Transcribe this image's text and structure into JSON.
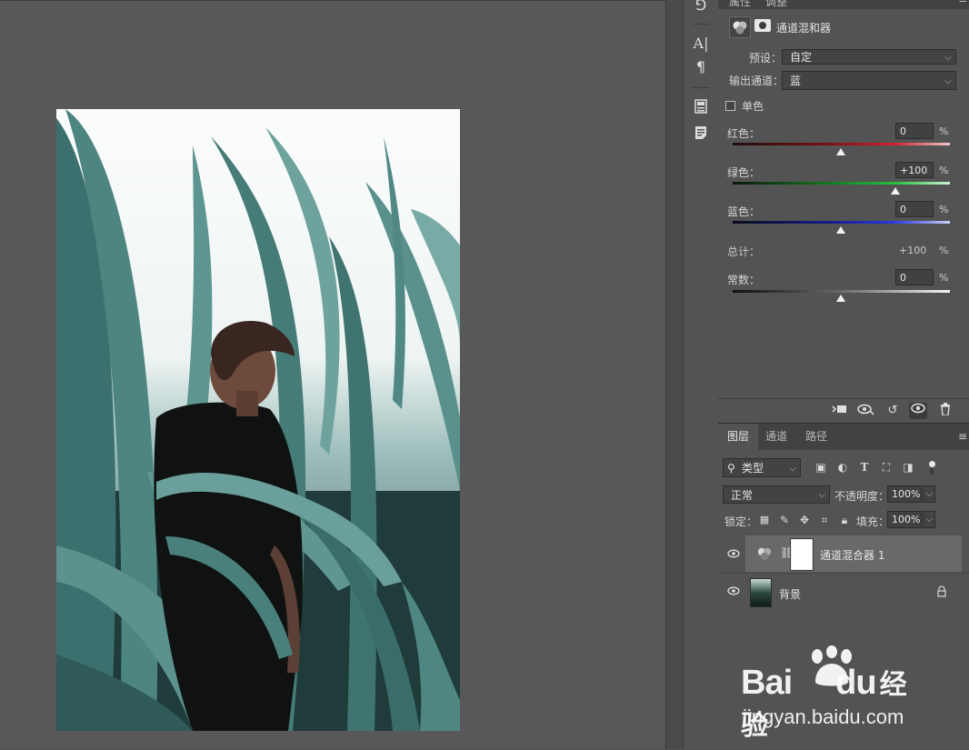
{
  "properties": {
    "tabs": [
      "属性",
      "调整"
    ],
    "title": "通道混和器",
    "preset_label": "预设：",
    "preset_value": "自定",
    "output_label": "输出通道：",
    "output_value": "蓝",
    "mono_label": "单色",
    "channels": [
      {
        "label": "红色：",
        "value": "0",
        "percent": "%",
        "color": "#c8202a",
        "slider": 0.5
      },
      {
        "label": "绿色：",
        "value": "+100",
        "percent": "%",
        "color": "#22b53a",
        "slider": 0.75
      },
      {
        "label": "蓝色：",
        "value": "0",
        "percent": "%",
        "color": "#2633d6",
        "slider": 0.5
      }
    ],
    "total_label": "总计：",
    "total_value": "+100",
    "total_percent": "%",
    "constant_label": "常数：",
    "constant_value": "0",
    "constant_percent": "%",
    "constant_slider": 0.5
  },
  "layers_panel": {
    "tabs": [
      "图层",
      "通道",
      "路径"
    ],
    "filter_label": "类型",
    "blend_mode": "正常",
    "opacity_label": "不透明度：",
    "opacity_value": "100%",
    "lock_label": "锁定：",
    "fill_label": "填充：",
    "fill_value": "100%",
    "layers": [
      {
        "name": "通道混合器 1",
        "selected": true
      },
      {
        "name": "背景",
        "selected": false
      }
    ]
  },
  "watermark": {
    "brand": "Bai",
    "brand2": "du",
    "suffix": "经验",
    "url": "jingyan.baidu.com"
  },
  "icons": [
    "channel-mixer-icon",
    "mask-icon",
    "eye-icon",
    "lock-icon",
    "trash-icon",
    "reset-icon",
    "chain-icon",
    "search-icon"
  ]
}
